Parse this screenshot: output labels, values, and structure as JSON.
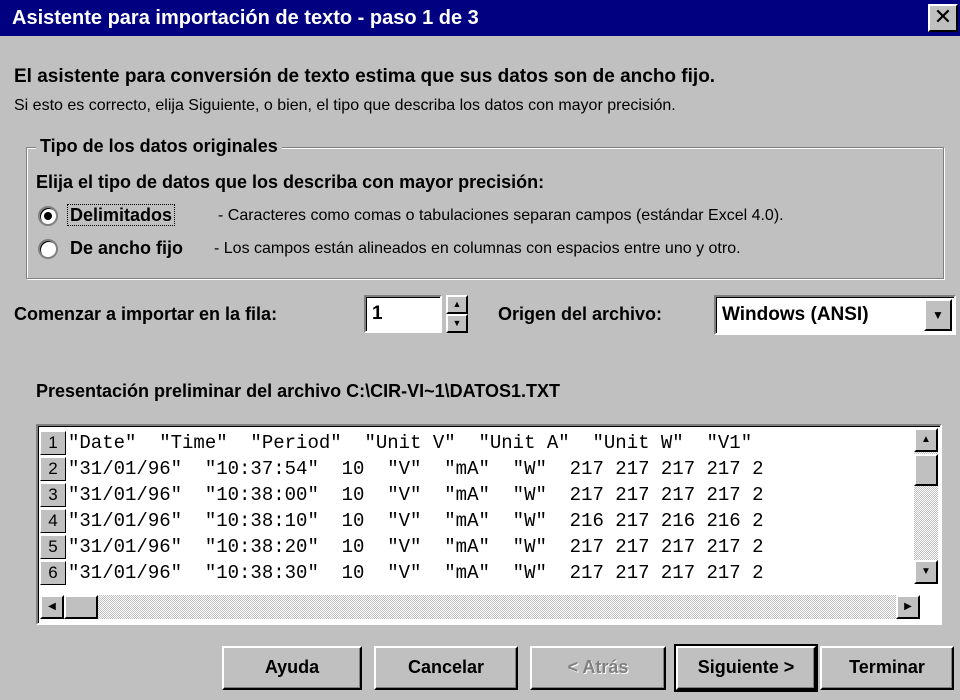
{
  "window": {
    "title": "Asistente para importación de texto - paso 1 de 3",
    "close_glyph": "✕"
  },
  "intro": {
    "heading": "El asistente para conversión de texto estima que sus datos son de ancho fijo.",
    "subtext": "Si esto es correcto, elija Siguiente, o bien, el tipo que describa los datos con mayor precisión."
  },
  "data_type": {
    "legend": "Tipo de los datos originales",
    "instruction": "Elija el tipo de datos que los describa con mayor precisión:",
    "options": [
      {
        "label": "Delimitados",
        "description": "- Caracteres como comas o tabulaciones separan campos (estándar Excel 4.0).",
        "selected": true
      },
      {
        "label": "De ancho fijo",
        "description": "- Los campos están alineados en columnas con espacios entre uno y otro.",
        "selected": false
      }
    ]
  },
  "start_row": {
    "label": "Comenzar a importar en la fila:",
    "value": "1"
  },
  "file_origin": {
    "label": "Origen del archivo:",
    "value": "Windows (ANSI)"
  },
  "preview": {
    "title": "Presentación preliminar del archivo C:\\CIR-VI~1\\DATOS1.TXT",
    "rows": [
      {
        "num": "1",
        "text": "\"Date\"  \"Time\"  \"Period\"  \"Unit V\"  \"Unit A\"  \"Unit W\"  \"V1\""
      },
      {
        "num": "2",
        "text": "\"31/01/96\"  \"10:37:54\"  10  \"V\"  \"mA\"  \"W\"  217 217 217 217 2"
      },
      {
        "num": "3",
        "text": "\"31/01/96\"  \"10:38:00\"  10  \"V\"  \"mA\"  \"W\"  217 217 217 217 2"
      },
      {
        "num": "4",
        "text": "\"31/01/96\"  \"10:38:10\"  10  \"V\"  \"mA\"  \"W\"  216 217 216 216 2"
      },
      {
        "num": "5",
        "text": "\"31/01/96\"  \"10:38:20\"  10  \"V\"  \"mA\"  \"W\"  217 217 217 217 2"
      },
      {
        "num": "6",
        "text": "\"31/01/96\"  \"10:38:30\"  10  \"V\"  \"mA\"  \"W\"  217 217 217 217 2"
      }
    ]
  },
  "buttons": {
    "help": "Ayuda",
    "cancel": "Cancelar",
    "back": "< Atrás",
    "next": "Siguiente >",
    "finish": "Terminar"
  }
}
